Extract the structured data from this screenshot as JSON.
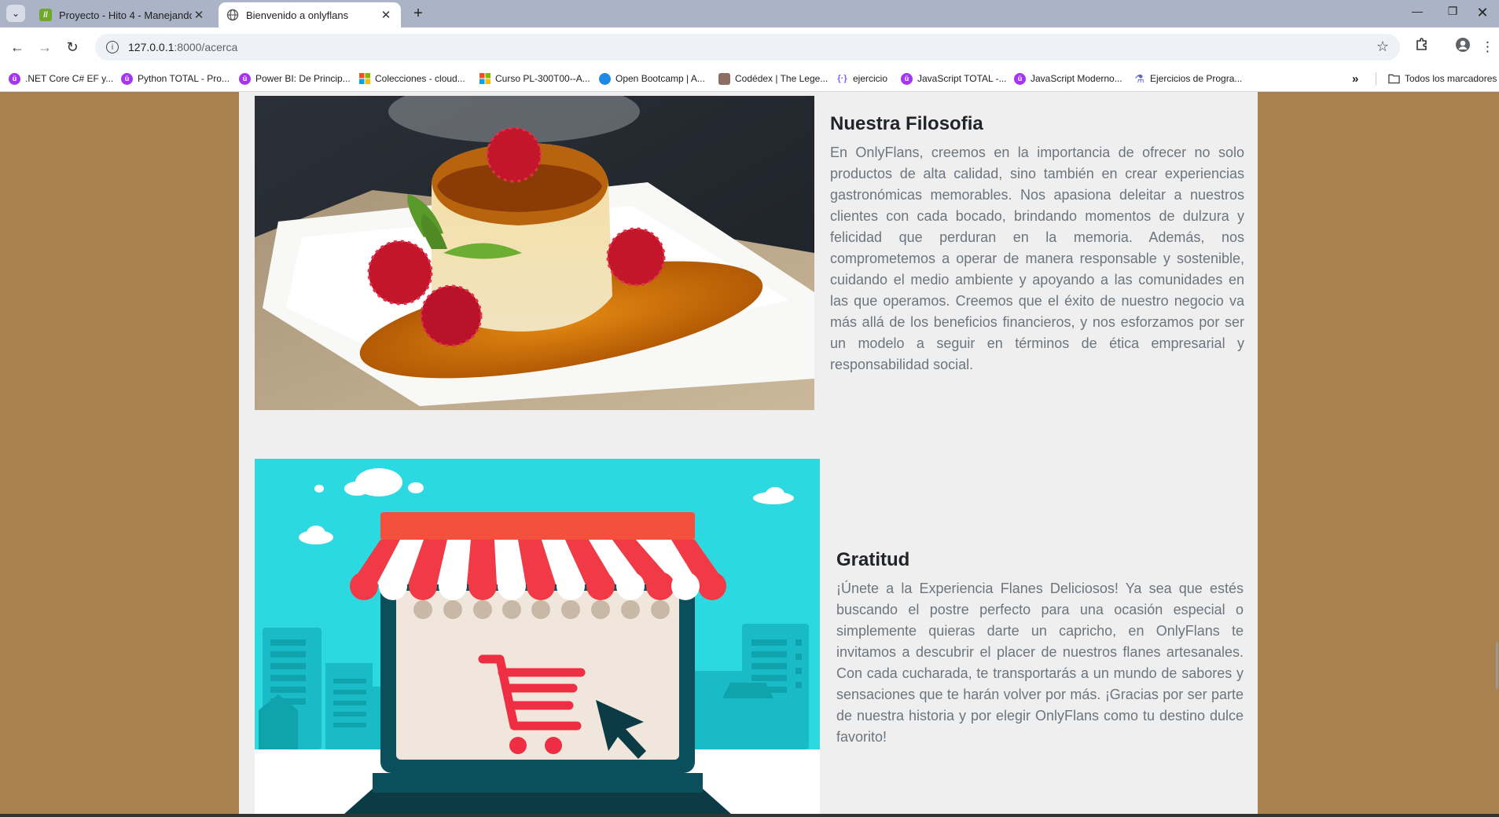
{
  "browser": {
    "tabs": [
      {
        "title": "Proyecto - Hito 4 - Manejando",
        "active": false,
        "favicon": "lightning-favicon"
      },
      {
        "title": "Bienvenido a onlyflans",
        "active": true,
        "favicon": "globe-icon"
      }
    ],
    "url_host": "127.0.0.1",
    "url_path": ":8000/acerca",
    "bookmarks": [
      {
        "label": ".NET Core C# EF y...",
        "icon": "udemy-icon",
        "color": "#a435f0"
      },
      {
        "label": "Python TOTAL - Pro...",
        "icon": "udemy-icon",
        "color": "#a435f0"
      },
      {
        "label": "Power BI: De Princip...",
        "icon": "udemy-icon",
        "color": "#a435f0"
      },
      {
        "label": "Colecciones - cloud...",
        "icon": "microsoft-icon",
        "color": "#f25022"
      },
      {
        "label": "Curso PL-300T00--A...",
        "icon": "microsoft-icon",
        "color": "#f25022"
      },
      {
        "label": "Open Bootcamp | A...",
        "icon": "bootcamp-icon",
        "color": "#1e88e5"
      },
      {
        "label": "Codédex | The Lege...",
        "icon": "codedex-icon",
        "color": "#6d4c41"
      },
      {
        "label": "ejercicio",
        "icon": "code-brackets-icon",
        "color": "#7b61ff"
      },
      {
        "label": "JavaScript TOTAL -...",
        "icon": "udemy-icon",
        "color": "#a435f0"
      },
      {
        "label": "JavaScript Moderno...",
        "icon": "udemy-icon",
        "color": "#a435f0"
      },
      {
        "label": "Ejercicios de Progra...",
        "icon": "flask-icon",
        "color": "#5c6bc0"
      }
    ],
    "more_bookmarks": "»",
    "all_bookmarks": "Todos los marcadores"
  },
  "page": {
    "background": "#a8814f",
    "sections": [
      {
        "title": "Nuestra Filosofia",
        "text": "En OnlyFlans, creemos en la importancia de ofrecer no solo productos de alta calidad, sino también en crear experiencias gastronómicas memorables. Nos apasiona deleitar a nuestros clientes con cada bocado, brindando momentos de dulzura y felicidad que perduran en la memoria. Además, nos comprometemos a operar de manera responsable y sostenible, cuidando el medio ambiente y apoyando a las comunidades en las que operamos. Creemos que el éxito de nuestro negocio va más allá de los beneficios financieros, y nos esforzamos por ser un modelo a seguir en términos de ética empresarial y responsabilidad social.",
        "image": "flan-with-raspberries-photo"
      },
      {
        "title": "Gratitud",
        "text": "¡Únete a la Experiencia Flanes Deliciosos! Ya sea que estés buscando el postre perfecto para una ocasión especial o simplemente quieras darte un capricho, en OnlyFlans te invitamos a descubrir el placer de nuestros flanes artesanales. Con cada cucharada, te transportarás a un mundo de sabores y sensaciones que te harán volver por más. ¡Gracias por ser parte de nuestra historia y por elegir OnlyFlans como tu destino dulce favorito!",
        "image": "online-store-illustration"
      }
    ]
  }
}
